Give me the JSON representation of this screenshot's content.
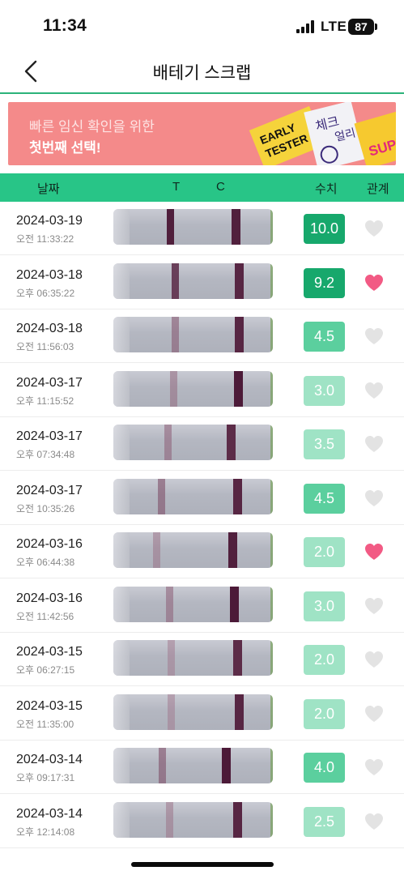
{
  "status_bar": {
    "time": "11:34",
    "network": "LTE",
    "battery": "87"
  },
  "nav": {
    "title": "배테기 스크랩",
    "back_icon": "chevron-left-icon"
  },
  "banner": {
    "line1": "빠른 임신 확인을 위한",
    "line2": "첫번째 선택!",
    "art_text": [
      "EARLY",
      "TESTER",
      "체크",
      "얼리",
      "SUPER"
    ],
    "background": "#f48a8a"
  },
  "table_header": {
    "date": "날짜",
    "t": "T",
    "c": "C",
    "value": "수치",
    "relation": "관계"
  },
  "colors": {
    "accent": "#28c587",
    "badge_dark": "#17a86c",
    "badge_medium": "#5bcf9e",
    "badge_light": "#9fe3c5",
    "heart_active": "#f25a84",
    "heart_inactive": "#e3e3e3"
  },
  "rows": [
    {
      "date": "2024-03-19",
      "time": "오전 11:33:22",
      "value": "10.0",
      "liked": false,
      "t_intensity": 0.95,
      "c_intensity": 0.9
    },
    {
      "date": "2024-03-18",
      "time": "오후 06:35:22",
      "value": "9.2",
      "liked": true,
      "t_intensity": 0.8,
      "c_intensity": 0.85
    },
    {
      "date": "2024-03-18",
      "time": "오전 11:56:03",
      "value": "4.5",
      "liked": false,
      "t_intensity": 0.4,
      "c_intensity": 0.85
    },
    {
      "date": "2024-03-17",
      "time": "오후 11:15:52",
      "value": "3.0",
      "liked": false,
      "t_intensity": 0.3,
      "c_intensity": 0.95
    },
    {
      "date": "2024-03-17",
      "time": "오후 07:34:48",
      "value": "3.5",
      "liked": false,
      "t_intensity": 0.35,
      "c_intensity": 0.8
    },
    {
      "date": "2024-03-17",
      "time": "오전 10:35:26",
      "value": "4.5",
      "liked": false,
      "t_intensity": 0.45,
      "c_intensity": 0.85
    },
    {
      "date": "2024-03-16",
      "time": "오후 06:44:38",
      "value": "2.0",
      "liked": true,
      "t_intensity": 0.25,
      "c_intensity": 0.9
    },
    {
      "date": "2024-03-16",
      "time": "오전 11:42:56",
      "value": "3.0",
      "liked": false,
      "t_intensity": 0.35,
      "c_intensity": 0.95
    },
    {
      "date": "2024-03-15",
      "time": "오후 06:27:15",
      "value": "2.0",
      "liked": false,
      "t_intensity": 0.2,
      "c_intensity": 0.8
    },
    {
      "date": "2024-03-15",
      "time": "오전 11:35:00",
      "value": "2.0",
      "liked": false,
      "t_intensity": 0.2,
      "c_intensity": 0.85
    },
    {
      "date": "2024-03-14",
      "time": "오후 09:17:31",
      "value": "4.0",
      "liked": false,
      "t_intensity": 0.45,
      "c_intensity": 0.95
    },
    {
      "date": "2024-03-14",
      "time": "오후 12:14:08",
      "value": "2.5",
      "liked": false,
      "t_intensity": 0.25,
      "c_intensity": 0.85
    }
  ]
}
